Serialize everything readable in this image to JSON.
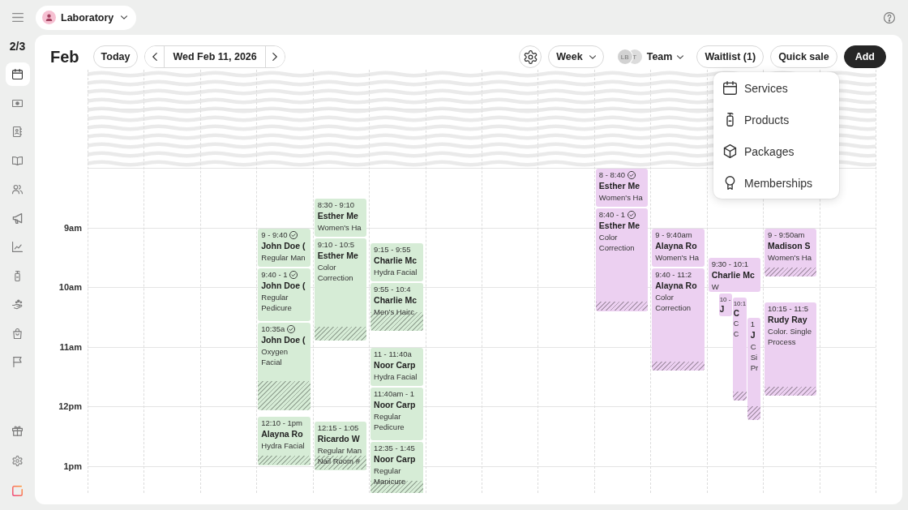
{
  "top_bar": {
    "location": "Laboratory"
  },
  "rail": {
    "page_indicator": "2/3",
    "items": [
      {
        "selected": true
      },
      {
        "selected": false
      },
      {
        "selected": false
      },
      {
        "selected": false
      },
      {
        "selected": false
      },
      {
        "selected": false
      },
      {
        "selected": false
      },
      {
        "selected": false
      },
      {
        "selected": false
      },
      {
        "selected": false
      },
      {
        "selected": false
      }
    ],
    "bottom_items": [
      {
        "selected": false
      },
      {
        "selected": false
      },
      {
        "selected": false
      }
    ]
  },
  "header": {
    "month": "Feb",
    "today": "Today",
    "date": "Wed Feb 11, 2026",
    "view": "Week",
    "team": {
      "label": "Team",
      "avatars": [
        "LB",
        "T"
      ]
    },
    "waitlist": "Waitlist (1)",
    "quick_sale": "Quick sale",
    "add": "Add"
  },
  "add_menu": {
    "items": [
      {
        "label": "Services"
      },
      {
        "label": "Products"
      },
      {
        "label": "Packages"
      },
      {
        "label": "Memberships"
      }
    ]
  },
  "calendar": {
    "hours": [
      "9am",
      "10am",
      "11am",
      "12pm",
      "1pm"
    ],
    "columns": [
      {},
      {},
      {},
      {
        "events": [
          {
            "time": "9 - 9:40",
            "confirmed": true,
            "client": "John Doe (",
            "service": "Regular Man",
            "buffer": false,
            "color": "#d6ecd6"
          },
          {
            "time": "9:40 - 1",
            "confirmed": true,
            "client": "John Doe (",
            "service": "Regular Pedicure",
            "buffer": false,
            "color": "#d6ecd6"
          },
          {
            "time": "10:35a",
            "confirmed": true,
            "client": "John Doe (",
            "service": "Oxygen Facial",
            "buffer": true,
            "color": "#d6ecd6"
          },
          {
            "time": "12:10 - 1pm",
            "confirmed": false,
            "client": "Alayna Ro",
            "service": "Hydra Facial",
            "buffer": true,
            "color": "#d6ecd6"
          }
        ]
      },
      {
        "events": [
          {
            "time": "8:30 - 9:10",
            "confirmed": false,
            "client": "Esther Me",
            "service": "Women's Ha",
            "buffer": false,
            "color": "#d6ecd6"
          },
          {
            "time": "9:10 - 10:5",
            "confirmed": false,
            "client": "Esther Me",
            "service": "Color Correction",
            "buffer": true,
            "color": "#d6ecd6"
          },
          {
            "time": "12:15 - 1:05",
            "confirmed": false,
            "client": "Ricardo W",
            "service": "Regular Man",
            "room": "Nail Room #",
            "buffer": true,
            "color": "#d6ecd6"
          }
        ]
      },
      {
        "events": [
          {
            "time": "9:15 - 9:55",
            "confirmed": false,
            "client": "Charlie Mc",
            "service": "Hydra Facial",
            "buffer": false,
            "color": "#d6ecd6"
          },
          {
            "time": "9:55 - 10:4",
            "confirmed": false,
            "client": "Charlie Mc",
            "service": "Men's Hairc",
            "buffer": true,
            "color": "#d6ecd6"
          },
          {
            "time": "11 - 11:40a",
            "confirmed": false,
            "client": "Noor Carp",
            "service": "Hydra Facial",
            "buffer": false,
            "color": "#d6ecd6"
          },
          {
            "time": "11:40am - 1",
            "confirmed": false,
            "client": "Noor Carp",
            "service": "Regular Pedicure",
            "buffer": false,
            "color": "#d6ecd6"
          },
          {
            "time": "12:35 - 1:45",
            "confirmed": false,
            "client": "Noor Carp",
            "service": "Regular Manicure",
            "buffer": true,
            "color": "#d6ecd6"
          }
        ]
      },
      {},
      {},
      {},
      {
        "events": [
          {
            "time": "8 - 8:40",
            "confirmed": true,
            "client": "Esther Me",
            "service": "Women's Ha",
            "buffer": false,
            "color": "#ecd0f1"
          },
          {
            "time": "8:40 - 1",
            "confirmed": true,
            "client": "Esther Me",
            "service": "Color Correction",
            "buffer": true,
            "color": "#ecd0f1"
          }
        ]
      },
      {
        "events": [
          {
            "time": "9 - 9:40am",
            "confirmed": false,
            "client": "Alayna Ro",
            "service": "Women's Ha",
            "buffer": false,
            "color": "#ecd0f1"
          },
          {
            "time": "9:40 - 11:2",
            "confirmed": false,
            "client": "Alayna Ro",
            "service": "Color Correction",
            "buffer": true,
            "color": "#ecd0f1"
          }
        ]
      },
      {
        "events": [
          {
            "time": "9:30 - 10:1",
            "confirmed": false,
            "client": "Charlie Mc",
            "service": "W",
            "buffer": false,
            "color": "#ecd0f1"
          },
          {
            "time": "10 -",
            "confirmed": false,
            "client": "J",
            "buffer": false,
            "color": "#ecd0f1"
          },
          {
            "time": "10:1",
            "confirmed": false,
            "client": "C",
            "service": "C C",
            "buffer": true,
            "color": "#ecd0f1"
          },
          {
            "time": "1",
            "confirmed": false,
            "client": "J",
            "service": "C Si Pr",
            "buffer": true,
            "color": "#ecd0f1"
          }
        ]
      },
      {
        "events": [
          {
            "time": "9 - 9:50am",
            "confirmed": false,
            "client": "Madison S",
            "service": "Women's Ha",
            "buffer": true,
            "color": "#ecd0f1"
          },
          {
            "time": "10:15 - 11:5",
            "confirmed": false,
            "client": "Rudy Ray",
            "service": "Color. Single Process",
            "buffer": true,
            "color": "#ecd0f1"
          }
        ]
      },
      {}
    ]
  }
}
